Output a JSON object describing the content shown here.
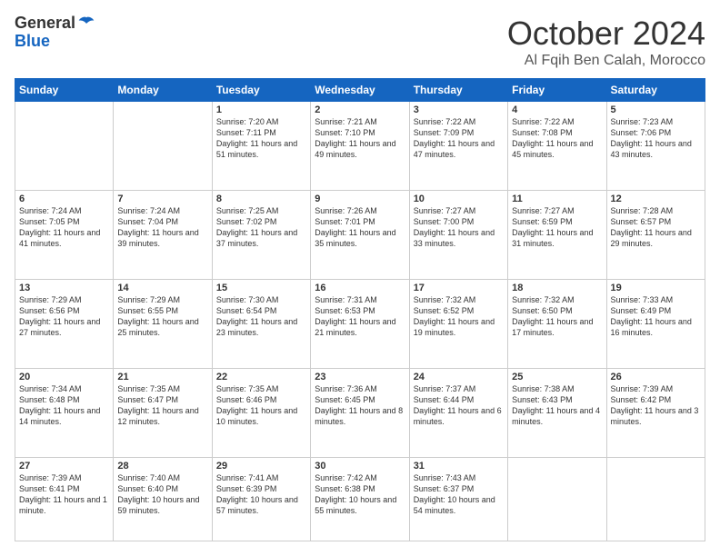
{
  "header": {
    "logo_line1": "General",
    "logo_line2": "Blue",
    "month_title": "October 2024",
    "location": "Al Fqih Ben Calah, Morocco"
  },
  "days_of_week": [
    "Sunday",
    "Monday",
    "Tuesday",
    "Wednesday",
    "Thursday",
    "Friday",
    "Saturday"
  ],
  "weeks": [
    [
      {
        "day": "",
        "sunrise": "",
        "sunset": "",
        "daylight": ""
      },
      {
        "day": "",
        "sunrise": "",
        "sunset": "",
        "daylight": ""
      },
      {
        "day": "1",
        "sunrise": "Sunrise: 7:20 AM",
        "sunset": "Sunset: 7:11 PM",
        "daylight": "Daylight: 11 hours and 51 minutes."
      },
      {
        "day": "2",
        "sunrise": "Sunrise: 7:21 AM",
        "sunset": "Sunset: 7:10 PM",
        "daylight": "Daylight: 11 hours and 49 minutes."
      },
      {
        "day": "3",
        "sunrise": "Sunrise: 7:22 AM",
        "sunset": "Sunset: 7:09 PM",
        "daylight": "Daylight: 11 hours and 47 minutes."
      },
      {
        "day": "4",
        "sunrise": "Sunrise: 7:22 AM",
        "sunset": "Sunset: 7:08 PM",
        "daylight": "Daylight: 11 hours and 45 minutes."
      },
      {
        "day": "5",
        "sunrise": "Sunrise: 7:23 AM",
        "sunset": "Sunset: 7:06 PM",
        "daylight": "Daylight: 11 hours and 43 minutes."
      }
    ],
    [
      {
        "day": "6",
        "sunrise": "Sunrise: 7:24 AM",
        "sunset": "Sunset: 7:05 PM",
        "daylight": "Daylight: 11 hours and 41 minutes."
      },
      {
        "day": "7",
        "sunrise": "Sunrise: 7:24 AM",
        "sunset": "Sunset: 7:04 PM",
        "daylight": "Daylight: 11 hours and 39 minutes."
      },
      {
        "day": "8",
        "sunrise": "Sunrise: 7:25 AM",
        "sunset": "Sunset: 7:02 PM",
        "daylight": "Daylight: 11 hours and 37 minutes."
      },
      {
        "day": "9",
        "sunrise": "Sunrise: 7:26 AM",
        "sunset": "Sunset: 7:01 PM",
        "daylight": "Daylight: 11 hours and 35 minutes."
      },
      {
        "day": "10",
        "sunrise": "Sunrise: 7:27 AM",
        "sunset": "Sunset: 7:00 PM",
        "daylight": "Daylight: 11 hours and 33 minutes."
      },
      {
        "day": "11",
        "sunrise": "Sunrise: 7:27 AM",
        "sunset": "Sunset: 6:59 PM",
        "daylight": "Daylight: 11 hours and 31 minutes."
      },
      {
        "day": "12",
        "sunrise": "Sunrise: 7:28 AM",
        "sunset": "Sunset: 6:57 PM",
        "daylight": "Daylight: 11 hours and 29 minutes."
      }
    ],
    [
      {
        "day": "13",
        "sunrise": "Sunrise: 7:29 AM",
        "sunset": "Sunset: 6:56 PM",
        "daylight": "Daylight: 11 hours and 27 minutes."
      },
      {
        "day": "14",
        "sunrise": "Sunrise: 7:29 AM",
        "sunset": "Sunset: 6:55 PM",
        "daylight": "Daylight: 11 hours and 25 minutes."
      },
      {
        "day": "15",
        "sunrise": "Sunrise: 7:30 AM",
        "sunset": "Sunset: 6:54 PM",
        "daylight": "Daylight: 11 hours and 23 minutes."
      },
      {
        "day": "16",
        "sunrise": "Sunrise: 7:31 AM",
        "sunset": "Sunset: 6:53 PM",
        "daylight": "Daylight: 11 hours and 21 minutes."
      },
      {
        "day": "17",
        "sunrise": "Sunrise: 7:32 AM",
        "sunset": "Sunset: 6:52 PM",
        "daylight": "Daylight: 11 hours and 19 minutes."
      },
      {
        "day": "18",
        "sunrise": "Sunrise: 7:32 AM",
        "sunset": "Sunset: 6:50 PM",
        "daylight": "Daylight: 11 hours and 17 minutes."
      },
      {
        "day": "19",
        "sunrise": "Sunrise: 7:33 AM",
        "sunset": "Sunset: 6:49 PM",
        "daylight": "Daylight: 11 hours and 16 minutes."
      }
    ],
    [
      {
        "day": "20",
        "sunrise": "Sunrise: 7:34 AM",
        "sunset": "Sunset: 6:48 PM",
        "daylight": "Daylight: 11 hours and 14 minutes."
      },
      {
        "day": "21",
        "sunrise": "Sunrise: 7:35 AM",
        "sunset": "Sunset: 6:47 PM",
        "daylight": "Daylight: 11 hours and 12 minutes."
      },
      {
        "day": "22",
        "sunrise": "Sunrise: 7:35 AM",
        "sunset": "Sunset: 6:46 PM",
        "daylight": "Daylight: 11 hours and 10 minutes."
      },
      {
        "day": "23",
        "sunrise": "Sunrise: 7:36 AM",
        "sunset": "Sunset: 6:45 PM",
        "daylight": "Daylight: 11 hours and 8 minutes."
      },
      {
        "day": "24",
        "sunrise": "Sunrise: 7:37 AM",
        "sunset": "Sunset: 6:44 PM",
        "daylight": "Daylight: 11 hours and 6 minutes."
      },
      {
        "day": "25",
        "sunrise": "Sunrise: 7:38 AM",
        "sunset": "Sunset: 6:43 PM",
        "daylight": "Daylight: 11 hours and 4 minutes."
      },
      {
        "day": "26",
        "sunrise": "Sunrise: 7:39 AM",
        "sunset": "Sunset: 6:42 PM",
        "daylight": "Daylight: 11 hours and 3 minutes."
      }
    ],
    [
      {
        "day": "27",
        "sunrise": "Sunrise: 7:39 AM",
        "sunset": "Sunset: 6:41 PM",
        "daylight": "Daylight: 11 hours and 1 minute."
      },
      {
        "day": "28",
        "sunrise": "Sunrise: 7:40 AM",
        "sunset": "Sunset: 6:40 PM",
        "daylight": "Daylight: 10 hours and 59 minutes."
      },
      {
        "day": "29",
        "sunrise": "Sunrise: 7:41 AM",
        "sunset": "Sunset: 6:39 PM",
        "daylight": "Daylight: 10 hours and 57 minutes."
      },
      {
        "day": "30",
        "sunrise": "Sunrise: 7:42 AM",
        "sunset": "Sunset: 6:38 PM",
        "daylight": "Daylight: 10 hours and 55 minutes."
      },
      {
        "day": "31",
        "sunrise": "Sunrise: 7:43 AM",
        "sunset": "Sunset: 6:37 PM",
        "daylight": "Daylight: 10 hours and 54 minutes."
      },
      {
        "day": "",
        "sunrise": "",
        "sunset": "",
        "daylight": ""
      },
      {
        "day": "",
        "sunrise": "",
        "sunset": "",
        "daylight": ""
      }
    ]
  ]
}
